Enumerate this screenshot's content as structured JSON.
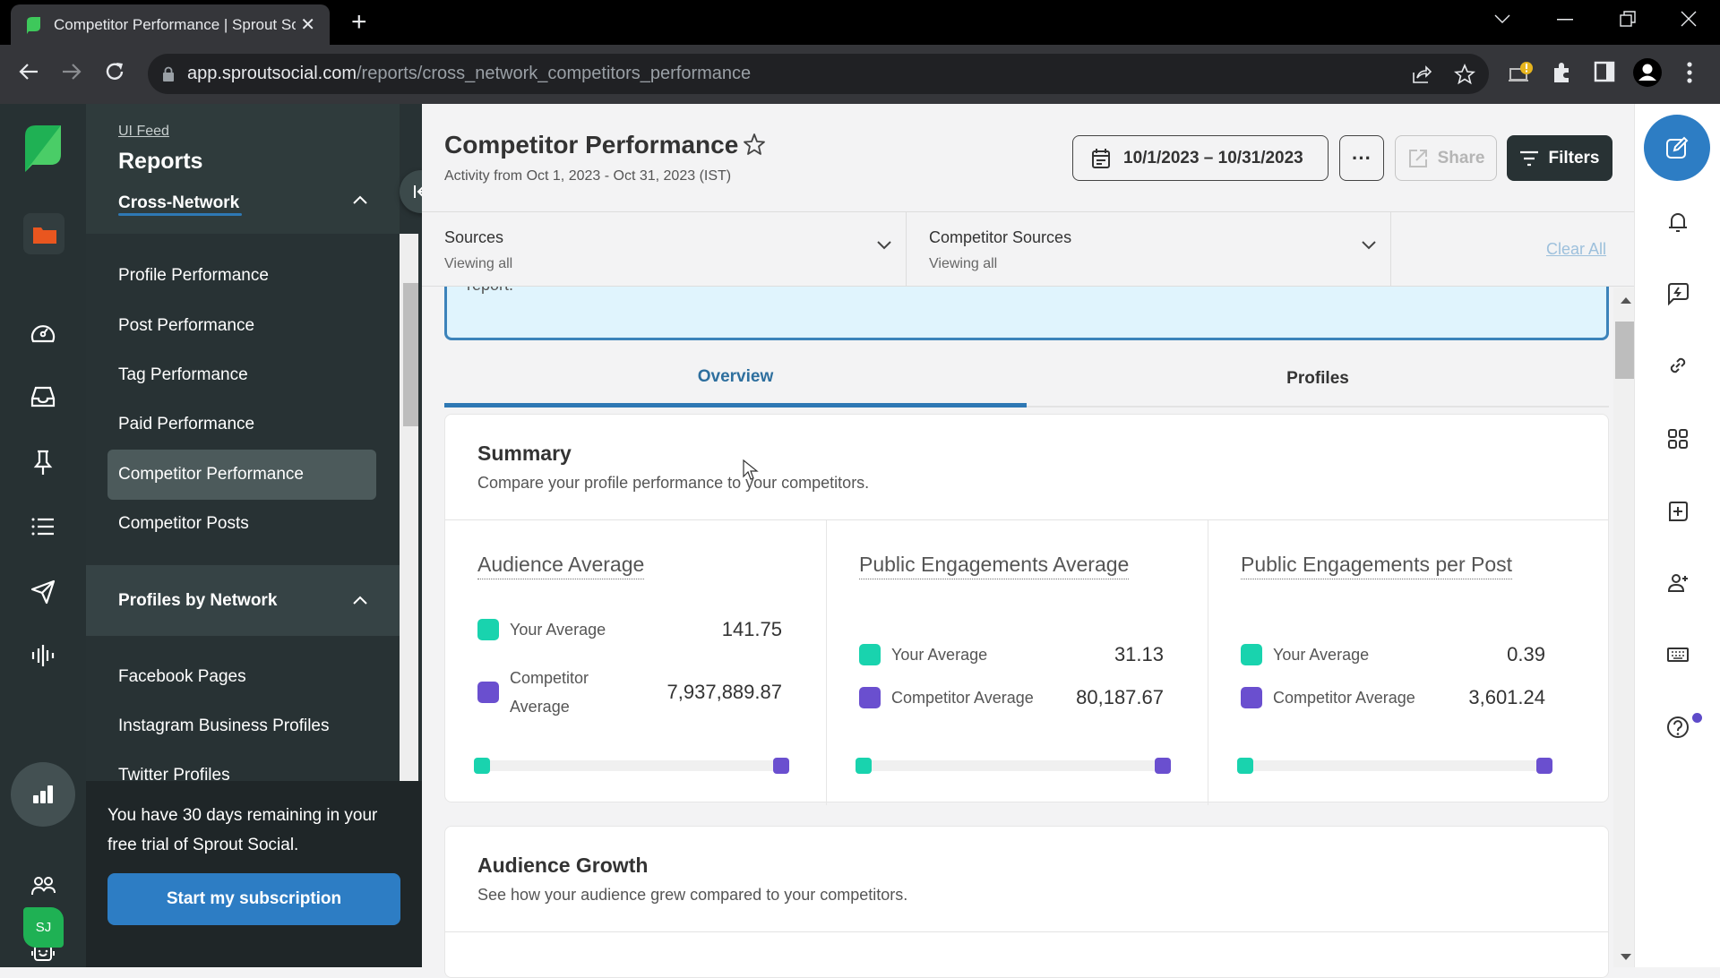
{
  "browser": {
    "tab_title": "Competitor Performance | Sprout Social",
    "url_host": "app.sproutsocial.com",
    "url_path": "/reports/cross_network_competitors_performance"
  },
  "sidebar": {
    "breadcrumb": "UI Feed",
    "title": "Reports",
    "sections": [
      {
        "label": "Cross-Network",
        "items": [
          {
            "label": "Profile Performance"
          },
          {
            "label": "Post Performance"
          },
          {
            "label": "Tag Performance"
          },
          {
            "label": "Paid Performance"
          },
          {
            "label": "Competitor Performance",
            "active": true
          },
          {
            "label": "Competitor Posts"
          }
        ]
      },
      {
        "label": "Profiles by Network",
        "items": [
          {
            "label": "Facebook Pages"
          },
          {
            "label": "Instagram Business Profiles"
          },
          {
            "label": "Twitter Profiles"
          }
        ]
      }
    ],
    "trial": {
      "message": "You have 30 days remaining in your free trial of Sprout Social.",
      "button": "Start my subscription"
    },
    "avatar_initials": "SJ"
  },
  "rail": {
    "icons": [
      "sprout-logo-icon",
      "folder-icon",
      "dashboard-icon",
      "inbox-icon",
      "pin-icon",
      "list-icon",
      "send-icon",
      "listening-icon",
      "reports-icon",
      "people-icon",
      "bot-icon"
    ]
  },
  "header": {
    "title": "Competitor Performance",
    "activity": "Activity from Oct 1, 2023 - Oct 31, 2023 (IST)",
    "date_range": "10/1/2023 – 10/31/2023",
    "more_label": "···",
    "share_label": "Share",
    "filters_label": "Filters"
  },
  "filters": {
    "sources": {
      "label": "Sources",
      "value": "Viewing all"
    },
    "competitor_sources": {
      "label": "Competitor Sources",
      "value": "Viewing all"
    },
    "clear_all": "Clear All"
  },
  "info_banner": {
    "text": "report."
  },
  "tabs": [
    {
      "label": "Overview",
      "active": true
    },
    {
      "label": "Profiles",
      "active": false
    }
  ],
  "summary": {
    "title": "Summary",
    "subtitle": "Compare your profile performance to your competitors.",
    "colors": {
      "yours": "#19d3ae",
      "competitor": "#6a4fcf"
    },
    "metrics": [
      {
        "title": "Audience Average",
        "your_label": "Your Average",
        "your_value": "141.75",
        "comp_label": "Competitor Average",
        "comp_value": "7,937,889.87"
      },
      {
        "title": "Public Engagements Average",
        "your_label": "Your Average",
        "your_value": "31.13",
        "comp_label": "Competitor Average",
        "comp_value": "80,187.67"
      },
      {
        "title": "Public Engagements per Post",
        "your_label": "Your Average",
        "your_value": "0.39",
        "comp_label": "Competitor Average",
        "comp_value": "3,601.24"
      }
    ]
  },
  "audience_growth": {
    "title": "Audience Growth",
    "subtitle": "See how your audience grew compared to your competitors."
  }
}
